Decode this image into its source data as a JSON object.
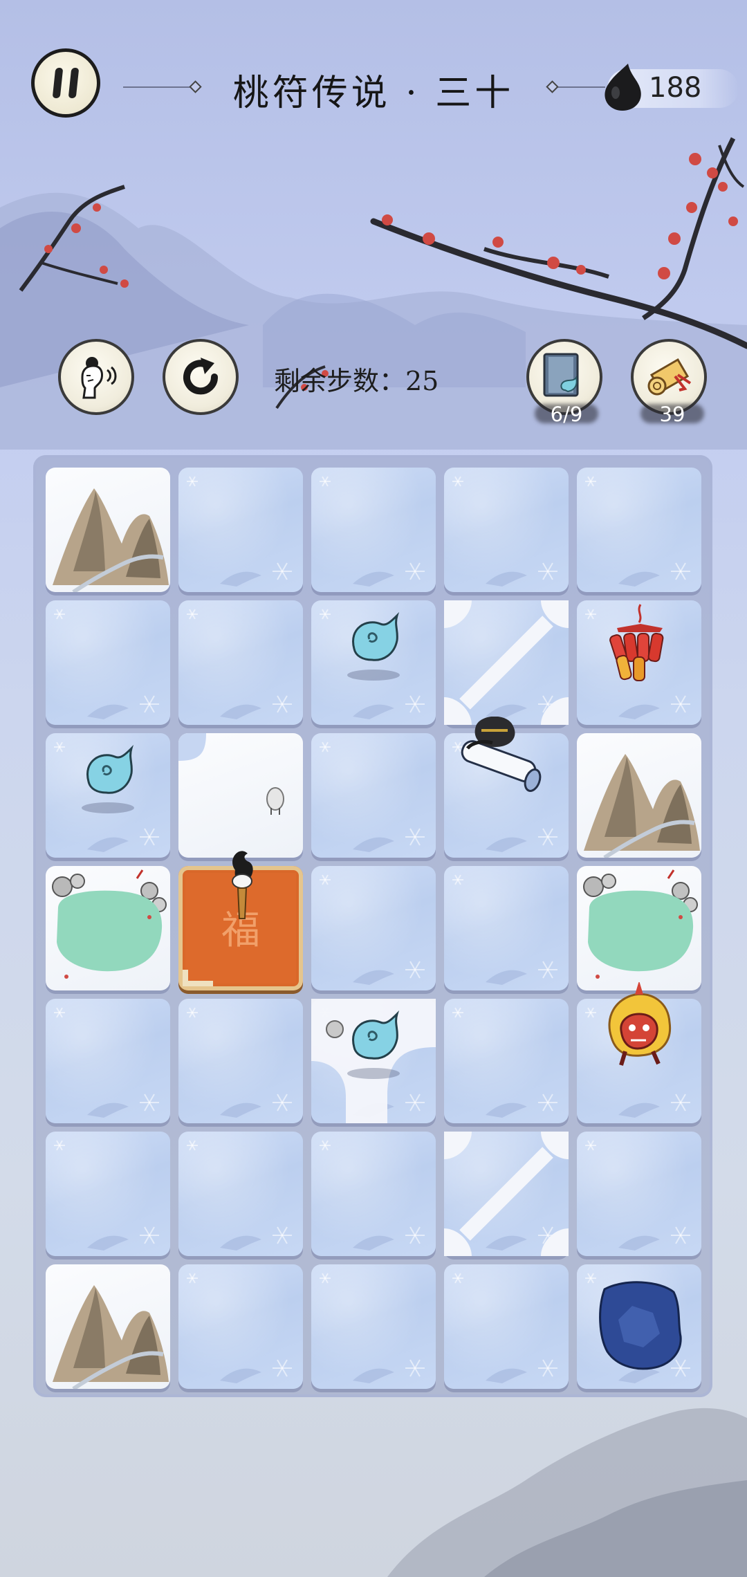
{
  "header": {
    "title": "桃符传说 · 三十",
    "ink_count": "188"
  },
  "controls": {
    "steps_label": "剩余步数：25",
    "charm_count": "6/9",
    "scroll_count": "39"
  },
  "icons": {
    "pause": "pause-icon",
    "hint": "hint-icon",
    "restart": "restart-icon",
    "ink": "ink-drop-icon",
    "charm_item": "charm-book-icon",
    "scroll_item": "scroll-icon"
  },
  "board": {
    "cols": 5,
    "rows": 7,
    "tiles": [
      [
        "mountain",
        "ice",
        "ice",
        "ice",
        "ice"
      ],
      [
        "ice",
        "ice",
        "ice",
        "ice",
        "ice"
      ],
      [
        "ice",
        "snow",
        "ice",
        "ice",
        "mountain"
      ],
      [
        "pond",
        "fu",
        "ice",
        "ice",
        "pond"
      ],
      [
        "ice",
        "ice",
        "ice",
        "ice",
        "ice"
      ],
      [
        "ice",
        "ice",
        "ice",
        "ice",
        "ice"
      ],
      [
        "mountain",
        "ice",
        "ice",
        "ice",
        "ice"
      ]
    ],
    "pieces": [
      {
        "row": 1,
        "col": 2,
        "type": "spirit-flame"
      },
      {
        "row": 1,
        "col": 4,
        "type": "firecracker"
      },
      {
        "row": 2,
        "col": 0,
        "type": "spirit-flame"
      },
      {
        "row": 2,
        "col": 3,
        "type": "hero-scroll"
      },
      {
        "row": 3,
        "col": 1,
        "type": "torch"
      },
      {
        "row": 4,
        "col": 2,
        "type": "spirit-flame"
      },
      {
        "row": 4,
        "col": 4,
        "type": "nian-beast"
      },
      {
        "row": 6,
        "col": 4,
        "type": "ice-hole"
      }
    ]
  },
  "colors": {
    "accent_dark": "#1c1c1c",
    "ice": "#c3d4f2",
    "fu_tile": "#d9682a",
    "spirit": "#7fd0e0"
  }
}
